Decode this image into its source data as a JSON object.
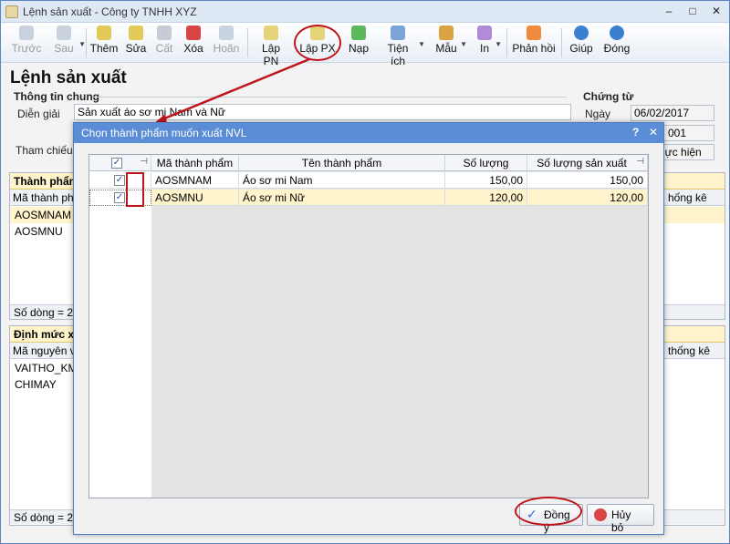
{
  "window": {
    "title": "Lệnh sản xuất - Công ty TNHH XYZ",
    "min": "–",
    "max": "□",
    "close": "✕"
  },
  "toolbar": [
    {
      "label": "Trước",
      "icon": "arrow-left-icon",
      "disabled": true
    },
    {
      "label": "Sau",
      "icon": "arrow-right-icon",
      "disabled": true,
      "dropdown": true
    },
    {
      "label": "Thêm",
      "icon": "add-document-icon"
    },
    {
      "label": "Sửa",
      "icon": "edit-icon"
    },
    {
      "label": "Cất",
      "icon": "save-icon",
      "disabled": true
    },
    {
      "label": "Xóa",
      "icon": "delete-icon"
    },
    {
      "label": "Hoãn",
      "icon": "undo-icon",
      "disabled": true
    },
    {
      "label": "Lập PN",
      "icon": "receipt-in-icon"
    },
    {
      "label": "Lập PX",
      "icon": "receipt-out-icon"
    },
    {
      "label": "Nạp",
      "icon": "refresh-icon"
    },
    {
      "label": "Tiện ích",
      "icon": "tools-icon",
      "dropdown": true
    },
    {
      "label": "Mẫu",
      "icon": "template-icon",
      "dropdown": true
    },
    {
      "label": "In",
      "icon": "print-icon",
      "dropdown": true
    },
    {
      "label": "Phản hồi",
      "icon": "mail-icon"
    },
    {
      "label": "Giúp",
      "icon": "help-icon"
    },
    {
      "label": "Đóng",
      "icon": "power-icon"
    }
  ],
  "page": {
    "title": "Lệnh sản xuất",
    "general_section": "Thông tin chung",
    "desc_label": "Diễn giải",
    "desc_value": "Sản xuất áo sơ mi Nam và Nữ",
    "ref_label": "Tham chiếu",
    "voucher_section": "Chứng từ",
    "date_label": "Ngày",
    "date_value": "06/02/2017",
    "number_fragment": "001",
    "status_fragment": "hực hiện"
  },
  "products_panel": {
    "title": "Thành phẩm",
    "col_code": "Mã thành phẩm",
    "col_stats": "hống kê",
    "rows": [
      "AOSMNAM",
      "AOSMNU"
    ],
    "footer": "Số dòng = 2"
  },
  "materials_panel": {
    "title": "Định mức xu",
    "col_code": "Mã nguyên vật",
    "col_stats": "thống kê",
    "rows": [
      "VAITHO_KM",
      "CHIMAY"
    ],
    "footer": "Số dòng = 2"
  },
  "dialog": {
    "title": "Chọn thành phẩm muốn xuất NVL",
    "help": "?",
    "close": "✕",
    "columns": [
      "Mã thành phẩm",
      "Tên thành phẩm",
      "Số lượng",
      "Số lượng sản xuất"
    ],
    "rows": [
      {
        "checked": true,
        "code": "AOSMNAM",
        "name": "Áo sơ mi Nam",
        "qty": "150,00",
        "prod_qty": "150,00"
      },
      {
        "checked": true,
        "code": "AOSMNU",
        "name": "Áo sơ mi Nữ",
        "qty": "120,00",
        "prod_qty": "120,00"
      }
    ],
    "ok": "Đồng ý",
    "cancel": "Hủy bỏ"
  },
  "colors": {
    "accent": "#5b8dd6",
    "highlight_row": "#fff4cc",
    "annotation_red": "#c0141b"
  }
}
